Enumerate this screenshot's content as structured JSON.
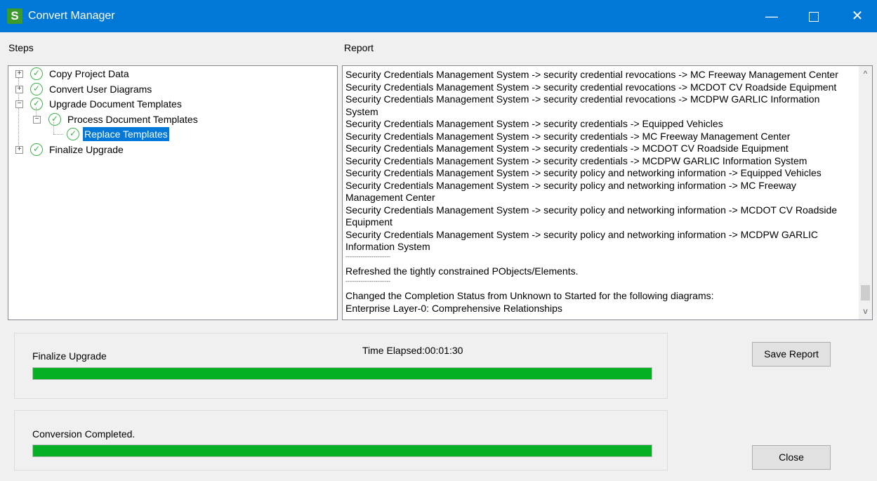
{
  "window": {
    "title": "Convert Manager",
    "app_icon_letter": "S",
    "min_glyph": "—",
    "close_glyph": "✕"
  },
  "steps": {
    "label": "Steps",
    "nodes": [
      {
        "label": "Copy Project Data",
        "expander": "+",
        "status": "completed"
      },
      {
        "label": "Convert User Diagrams",
        "expander": "+",
        "status": "completed"
      },
      {
        "label": "Upgrade Document Templates",
        "expander": "−",
        "status": "completed"
      },
      {
        "label": "Process Document Templates",
        "expander": "−",
        "status": "completed"
      },
      {
        "label": "Replace Templates",
        "expander": "",
        "status": "completed",
        "selected": true
      },
      {
        "label": "Finalize Upgrade",
        "expander": "+",
        "status": "completed"
      }
    ],
    "check_glyph": "✓"
  },
  "report": {
    "label": "Report",
    "lines": [
      "Security Credentials Management System -> security credential revocations -> MC Freeway Management Center",
      "Security Credentials Management System -> security credential revocations -> MCDOT CV Roadside Equipment",
      "Security Credentials Management System -> security credential revocations -> MCDPW GARLIC Information System",
      "Security Credentials Management System -> security credentials -> Equipped Vehicles",
      "Security Credentials Management System -> security credentials -> MC Freeway Management Center",
      "Security Credentials Management System -> security credentials -> MCDOT CV Roadside Equipment",
      "Security Credentials Management System -> security credentials -> MCDPW GARLIC Information System",
      "Security Credentials Management System -> security policy and networking information -> Equipped Vehicles",
      "Security Credentials Management System -> security policy and networking information -> MC Freeway Management Center",
      "Security Credentials Management System -> security policy and networking information -> MCDOT CV Roadside Equipment",
      "Security Credentials Management System -> security policy and networking information -> MCDPW GARLIC Information System"
    ],
    "separator": "------------------------",
    "refreshed": "Refreshed the tightly constrained PObjects/Elements.",
    "changed": "Changed the Completion Status from Unknown to Started for the following diagrams:",
    "diagram": "Enterprise Layer-0: Comprehensive Relationships",
    "scroll_up_glyph": "^",
    "scroll_down_glyph": "v"
  },
  "progress1": {
    "label": "Finalize Upgrade",
    "elapsed_label": "Time Elapsed:",
    "elapsed_value": "00:01:30",
    "value_percent": 100
  },
  "progress2": {
    "label": "Conversion Completed.",
    "value_percent": 100
  },
  "buttons": {
    "save": "Save Report",
    "close": "Close"
  },
  "colors": {
    "titlebar": "#0078d7",
    "progress_fill": "#06b025",
    "check": "#3db34a",
    "selection": "#0078d7"
  }
}
